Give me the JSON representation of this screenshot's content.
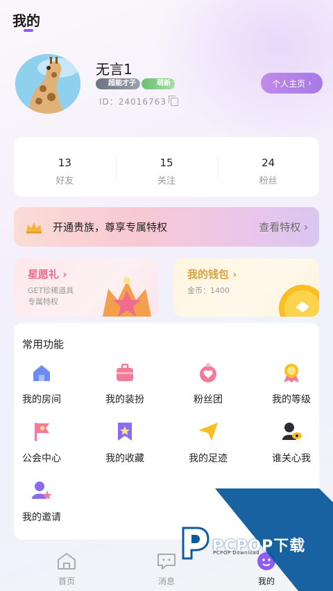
{
  "header": {
    "title": "我的"
  },
  "profile": {
    "nickname": "无言1",
    "badges": [
      "超能才子",
      "萌新"
    ],
    "uid": "ID：24016763",
    "homepage_button": "个人主页"
  },
  "stats": [
    {
      "value": "13",
      "label": "好友"
    },
    {
      "value": "15",
      "label": "关注"
    },
    {
      "value": "24",
      "label": "粉丝"
    }
  ],
  "vip_banner": {
    "text": "开通贵族，尊享专属特权",
    "link": "查看特权"
  },
  "promos": {
    "wish": {
      "title": "星愿礼",
      "line1": "GET珍稀道具",
      "line2": "专属特权"
    },
    "wallet": {
      "title": "我的钱包",
      "coins": "金币：1400"
    }
  },
  "functions": {
    "title": "常用功能",
    "items": [
      {
        "label": "我的房间",
        "icon": "house-icon"
      },
      {
        "label": "我的装扮",
        "icon": "dress-box-icon"
      },
      {
        "label": "粉丝团",
        "icon": "heart-badge-icon"
      },
      {
        "label": "我的等级",
        "icon": "medal-icon"
      },
      {
        "label": "公会中心",
        "icon": "flag-icon"
      },
      {
        "label": "我的收藏",
        "icon": "bookmark-star-icon"
      },
      {
        "label": "我的足迹",
        "icon": "paper-plane-icon"
      },
      {
        "label": "谁关心我",
        "icon": "person-eye-icon"
      },
      {
        "label": "我的邀请",
        "icon": "person-star-icon"
      }
    ]
  },
  "tabbar": {
    "items": [
      {
        "label": "首页",
        "icon": "home-icon",
        "active": false
      },
      {
        "label": "消息",
        "icon": "chat-icon",
        "active": false
      },
      {
        "label": "我的",
        "icon": "profile-icon",
        "active": true
      }
    ]
  },
  "watermark": {
    "text": "PCPOP下载",
    "sub": "PCPOP Download"
  },
  "colors": {
    "accent": "#8b5cf6",
    "button": "#b183e6",
    "vip_pink": "#f8c9d3",
    "wish_pink": "#f06b8c",
    "wallet_gold": "#d9a23c"
  }
}
